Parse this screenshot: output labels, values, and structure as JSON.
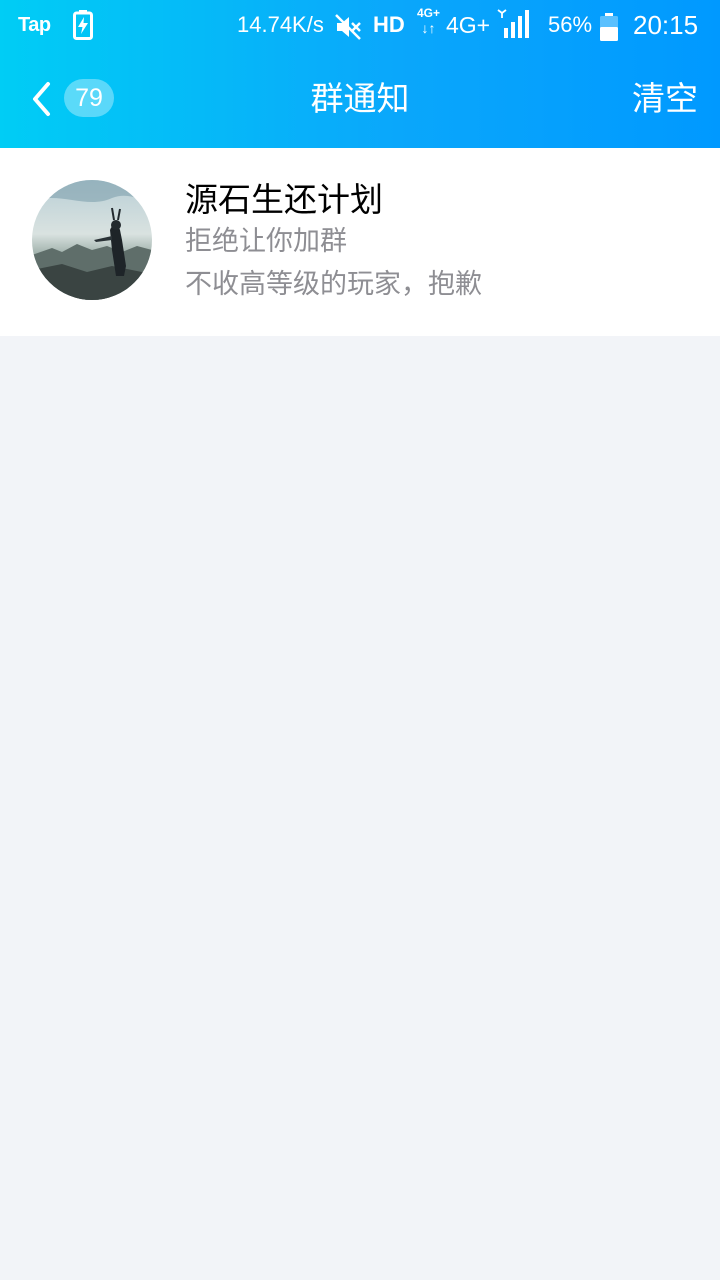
{
  "status_bar": {
    "app_label": "Tap",
    "charging_icon": "battery-charging-icon",
    "network_speed": "14.74K/s",
    "mute_icon": "mute-icon",
    "hd_label": "HD",
    "network_small_label": "4G+",
    "network_label": "4G+",
    "signal_icon": "signal-icon",
    "battery_percent": "56%",
    "battery_icon": "battery-icon",
    "time": "20:15"
  },
  "header": {
    "back_icon": "chevron-left-icon",
    "unread_count": "79",
    "title": "群通知",
    "clear_label": "清空"
  },
  "notices": [
    {
      "group_name": "源石生还计划",
      "status": "拒绝让你加群",
      "reason": "不收高等级的玩家，抱歉"
    }
  ],
  "colors": {
    "header_gradient_start": "#00cdf5",
    "header_gradient_end": "#0099ff",
    "page_background": "#f2f4f8",
    "secondary_text": "#8e8e93"
  }
}
